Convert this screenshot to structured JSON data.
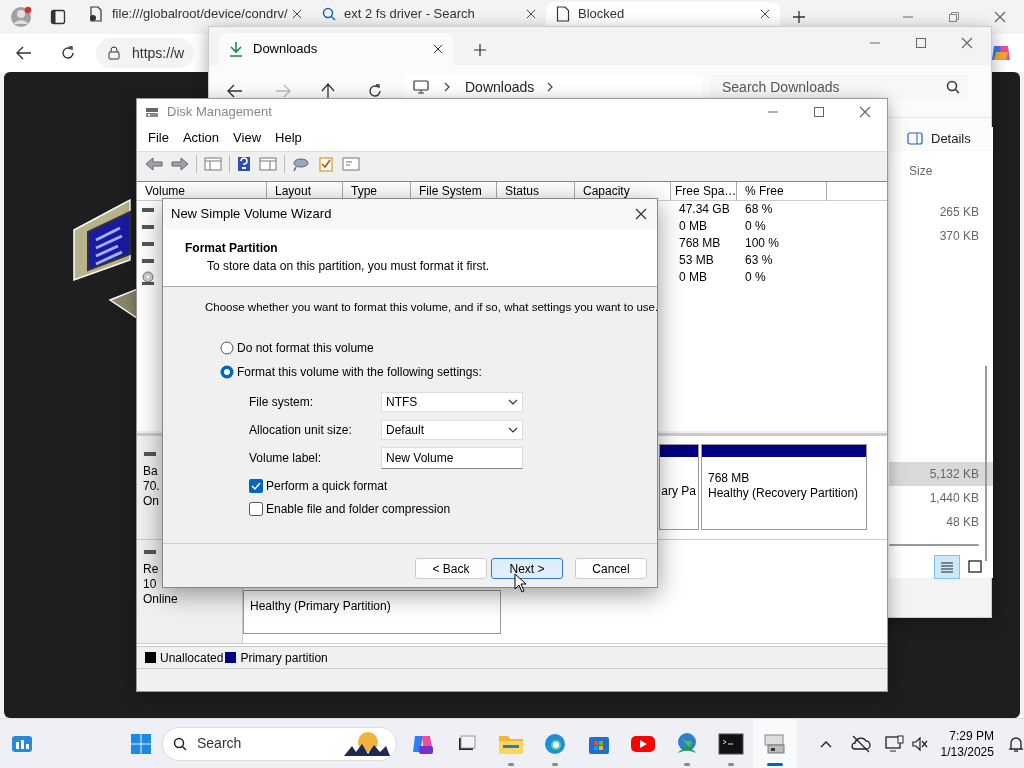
{
  "browser": {
    "tabs": [
      {
        "title": "file:///globalroot/device/condrv/",
        "selected": false
      },
      {
        "title": "ext 2 fs driver - Search",
        "selected": false
      },
      {
        "title": "Blocked",
        "selected": true
      }
    ],
    "address": "https://w"
  },
  "explorer": {
    "tab": "Downloads",
    "breadcrumb": "Downloads",
    "search": {
      "placeholder": "Search Downloads"
    },
    "details_button": "Details",
    "size_header": "Size",
    "groups": [
      {
        "files": [
          {
            "size": "265 KB",
            "selected": false
          },
          {
            "size": "370 KB",
            "selected": false
          }
        ]
      },
      {
        "files": [
          {
            "size": "5,132 KB",
            "selected": true
          },
          {
            "size": "1,440 KB",
            "selected": false
          },
          {
            "size": "48 KB",
            "selected": false
          }
        ]
      }
    ],
    "views": [
      {
        "kind": "details",
        "selected": true
      },
      {
        "kind": "tiles",
        "selected": false
      }
    ]
  },
  "disk_management": {
    "title": "Disk Management",
    "menu": [
      "File",
      "Action",
      "View",
      "Help"
    ],
    "columns": [
      "Volume",
      "Layout",
      "Type",
      "File System",
      "Status",
      "Capacity",
      "Free Spa…",
      "% Free"
    ],
    "rows": [
      {
        "kind": "disk",
        "free_space": "47.34 GB",
        "percent_free": "68 %"
      },
      {
        "kind": "disk",
        "free_space": "0 MB",
        "percent_free": "0 %"
      },
      {
        "kind": "disk",
        "free_space": "768 MB",
        "percent_free": "100 %"
      },
      {
        "kind": "disk",
        "free_space": "53 MB",
        "percent_free": "63 %"
      },
      {
        "kind": "cd",
        "free_space": "0 MB",
        "percent_free": "0 %"
      }
    ],
    "disks": [
      {
        "info": [
          "Ba",
          "70.",
          "On"
        ],
        "partitions": [
          {
            "lines": [
              "ary Pa"
            ]
          },
          {
            "lines": [
              "768 MB",
              "Healthy (Recovery Partition)"
            ]
          }
        ]
      },
      {
        "info": [
          "Re",
          "10",
          "Online"
        ],
        "partitions": [
          {
            "lines": [
              "Healthy (Primary Partition)"
            ]
          }
        ]
      }
    ],
    "legend": [
      {
        "label": "Unallocated",
        "color": "#000000"
      },
      {
        "label": "Primary partition",
        "color": "#000080"
      }
    ]
  },
  "wizard": {
    "title": "New Simple Volume Wizard",
    "heading": "Format Partition",
    "subheading": "To store data on this partition, you must format it first.",
    "intro": "Choose whether you want to format this volume, and if so, what settings you want to use.",
    "options": [
      {
        "label": "Do not format this volume",
        "selected": false
      },
      {
        "label": "Format this volume with the following settings:",
        "selected": true
      }
    ],
    "fields": [
      {
        "label": "File system:",
        "kind": "select",
        "value": "NTFS"
      },
      {
        "label": "Allocation unit size:",
        "kind": "select",
        "value": "Default"
      },
      {
        "label": "Volume label:",
        "kind": "text",
        "value": "New Volume"
      }
    ],
    "checkboxes": [
      {
        "label": "Perform a quick format",
        "checked": true
      },
      {
        "label": "Enable file and folder compression",
        "checked": false
      }
    ],
    "buttons": [
      {
        "label": "< Back",
        "focused": false
      },
      {
        "label": "Next >",
        "focused": true
      },
      {
        "label": "Cancel",
        "focused": false
      }
    ]
  },
  "taskbar": {
    "search": {
      "placeholder": "Search"
    },
    "apps": [
      {
        "kind": "copilot",
        "running": false,
        "selected": false
      },
      {
        "kind": "taskview",
        "running": false,
        "selected": false
      },
      {
        "kind": "folder",
        "running": true,
        "selected": false
      },
      {
        "kind": "edge",
        "running": true,
        "selected": false
      },
      {
        "kind": "store",
        "running": false,
        "selected": false
      },
      {
        "kind": "youtube",
        "running": false,
        "selected": false
      },
      {
        "kind": "globe",
        "running": true,
        "selected": false
      },
      {
        "kind": "terminal",
        "running": true,
        "selected": false
      },
      {
        "kind": "disk",
        "running": false,
        "selected": true
      }
    ],
    "time": "7:29 PM",
    "date": "1/13/2025"
  }
}
